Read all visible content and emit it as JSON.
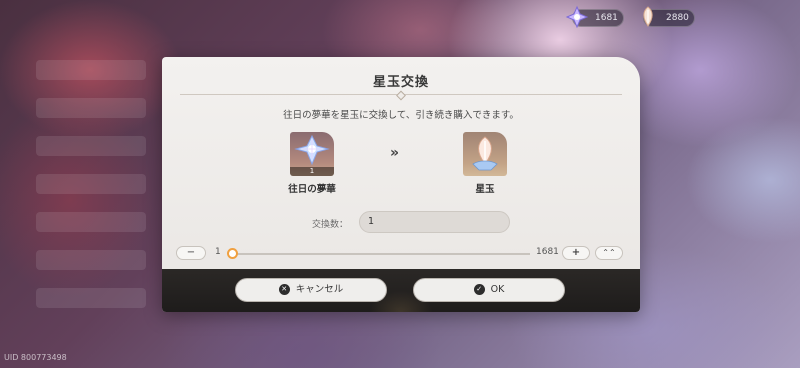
{
  "currency": {
    "dream_count": "1681",
    "jade_count": "2880"
  },
  "uid": "UID 800773498",
  "dialog": {
    "title": "星玉交換",
    "description": "往日の夢華を星玉に交換して、引き続き購入できます。",
    "from_item": {
      "name": "往日の夢華",
      "count": "1",
      "icon": "dream-flower-icon"
    },
    "to_item": {
      "name": "星玉",
      "icon": "stellar-jade-icon"
    },
    "arrow": "»",
    "quantity_label": "交換数：",
    "quantity_value": "1",
    "slider": {
      "min_label": "1",
      "max_label": "1681",
      "value": 1,
      "min": 1,
      "max": 1681
    },
    "minus_label": "−",
    "plus_label": "+",
    "max_label": "⌃⌃",
    "cancel_label": "キャンセル",
    "ok_label": "OK"
  },
  "colors": {
    "slider_accent": "#f0a040",
    "footer_bg": "#1e1c1b",
    "dialog_bg": "#f3f1ef"
  }
}
